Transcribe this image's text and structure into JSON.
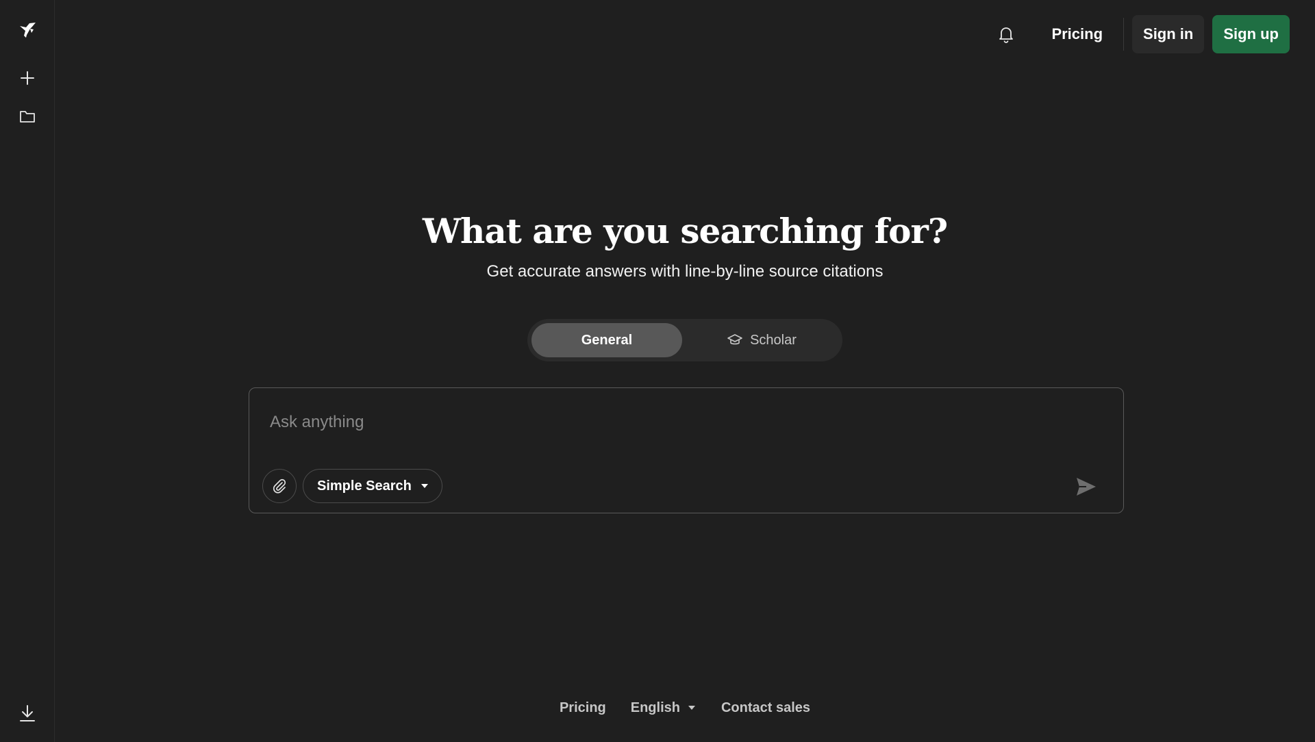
{
  "sidebar": {
    "logo_icon": "bird-logo-icon",
    "new_icon": "plus-icon",
    "folder_icon": "folder-icon",
    "download_icon": "download-icon"
  },
  "header": {
    "bell_icon": "bell-icon",
    "pricing_label": "Pricing",
    "signin_label": "Sign in",
    "signup_label": "Sign up"
  },
  "hero": {
    "title": "What are you searching for?",
    "subtitle": "Get accurate answers with line-by-line source citations"
  },
  "modes": {
    "general_label": "General",
    "scholar_label": "Scholar",
    "scholar_icon": "graduation-cap-icon",
    "active": "General"
  },
  "search": {
    "placeholder": "Ask anything",
    "value": "",
    "attach_icon": "paperclip-icon",
    "type_label": "Simple Search",
    "type_icon": "caret-down-icon",
    "send_icon": "send-icon"
  },
  "footer": {
    "pricing_label": "Pricing",
    "language_label": "English",
    "contact_label": "Contact sales"
  },
  "colors": {
    "background": "#1f1f1f",
    "signup_green": "#1f6f43",
    "active_tab": "#585858"
  }
}
